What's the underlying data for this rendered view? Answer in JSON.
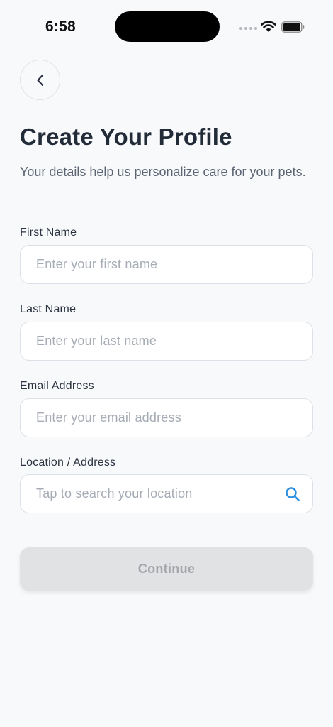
{
  "status_bar": {
    "time": "6:58"
  },
  "header": {
    "back_icon": "chevron-left-icon",
    "title": "Create Your Profile",
    "subtitle": "Your details help us personalize care for your pets."
  },
  "form": {
    "first_name": {
      "label": "First Name",
      "placeholder": "Enter your first name",
      "value": ""
    },
    "last_name": {
      "label": "Last Name",
      "placeholder": "Enter your last name",
      "value": ""
    },
    "email": {
      "label": "Email Address",
      "placeholder": "Enter your email address",
      "value": ""
    },
    "location": {
      "label": "Location / Address",
      "placeholder": "Tap to search your location",
      "icon": "search-icon"
    }
  },
  "actions": {
    "continue_label": "Continue",
    "continue_disabled": true
  },
  "colors": {
    "background": "#f8f9fb",
    "title": "#222b38",
    "accent": "#2b8fe0",
    "button_disabled_bg": "#e1e2e4",
    "button_disabled_text": "#a3a6ab"
  }
}
